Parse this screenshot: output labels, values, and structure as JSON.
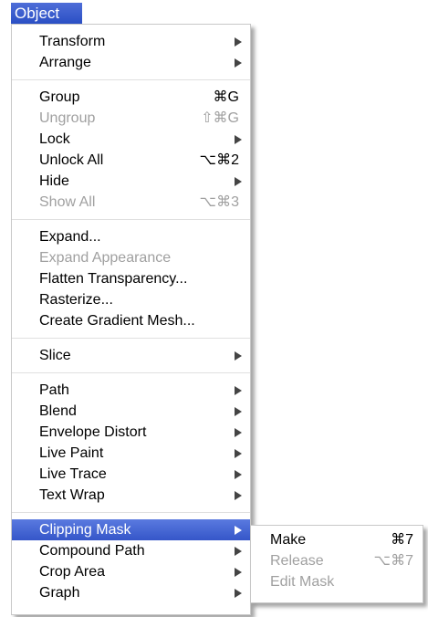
{
  "menu_title": "Object",
  "groups": [
    [
      {
        "label": "Transform",
        "shortcut": "",
        "submenu": true,
        "enabled": true
      },
      {
        "label": "Arrange",
        "shortcut": "",
        "submenu": true,
        "enabled": true
      }
    ],
    [
      {
        "label": "Group",
        "shortcut": "⌘G",
        "submenu": false,
        "enabled": true
      },
      {
        "label": "Ungroup",
        "shortcut": "⇧⌘G",
        "submenu": false,
        "enabled": false
      },
      {
        "label": "Lock",
        "shortcut": "",
        "submenu": true,
        "enabled": true
      },
      {
        "label": "Unlock All",
        "shortcut": "⌥⌘2",
        "submenu": false,
        "enabled": true
      },
      {
        "label": "Hide",
        "shortcut": "",
        "submenu": true,
        "enabled": true
      },
      {
        "label": "Show All",
        "shortcut": "⌥⌘3",
        "submenu": false,
        "enabled": false
      }
    ],
    [
      {
        "label": "Expand...",
        "shortcut": "",
        "submenu": false,
        "enabled": true
      },
      {
        "label": "Expand Appearance",
        "shortcut": "",
        "submenu": false,
        "enabled": false
      },
      {
        "label": "Flatten Transparency...",
        "shortcut": "",
        "submenu": false,
        "enabled": true
      },
      {
        "label": "Rasterize...",
        "shortcut": "",
        "submenu": false,
        "enabled": true
      },
      {
        "label": "Create Gradient Mesh...",
        "shortcut": "",
        "submenu": false,
        "enabled": true
      }
    ],
    [
      {
        "label": "Slice",
        "shortcut": "",
        "submenu": true,
        "enabled": true
      }
    ],
    [
      {
        "label": "Path",
        "shortcut": "",
        "submenu": true,
        "enabled": true
      },
      {
        "label": "Blend",
        "shortcut": "",
        "submenu": true,
        "enabled": true
      },
      {
        "label": "Envelope Distort",
        "shortcut": "",
        "submenu": true,
        "enabled": true
      },
      {
        "label": "Live Paint",
        "shortcut": "",
        "submenu": true,
        "enabled": true
      },
      {
        "label": "Live Trace",
        "shortcut": "",
        "submenu": true,
        "enabled": true
      },
      {
        "label": "Text Wrap",
        "shortcut": "",
        "submenu": true,
        "enabled": true
      }
    ],
    [
      {
        "label": "Clipping Mask",
        "shortcut": "",
        "submenu": true,
        "enabled": true,
        "selected": true
      },
      {
        "label": "Compound Path",
        "shortcut": "",
        "submenu": true,
        "enabled": true
      },
      {
        "label": "Crop Area",
        "shortcut": "",
        "submenu": true,
        "enabled": true
      },
      {
        "label": "Graph",
        "shortcut": "",
        "submenu": true,
        "enabled": true
      }
    ]
  ],
  "clipping_mask_submenu": [
    {
      "label": "Make",
      "shortcut": "⌘7",
      "enabled": true
    },
    {
      "label": "Release",
      "shortcut": "⌥⌘7",
      "enabled": false
    },
    {
      "label": "Edit Mask",
      "shortcut": "",
      "enabled": false
    }
  ]
}
